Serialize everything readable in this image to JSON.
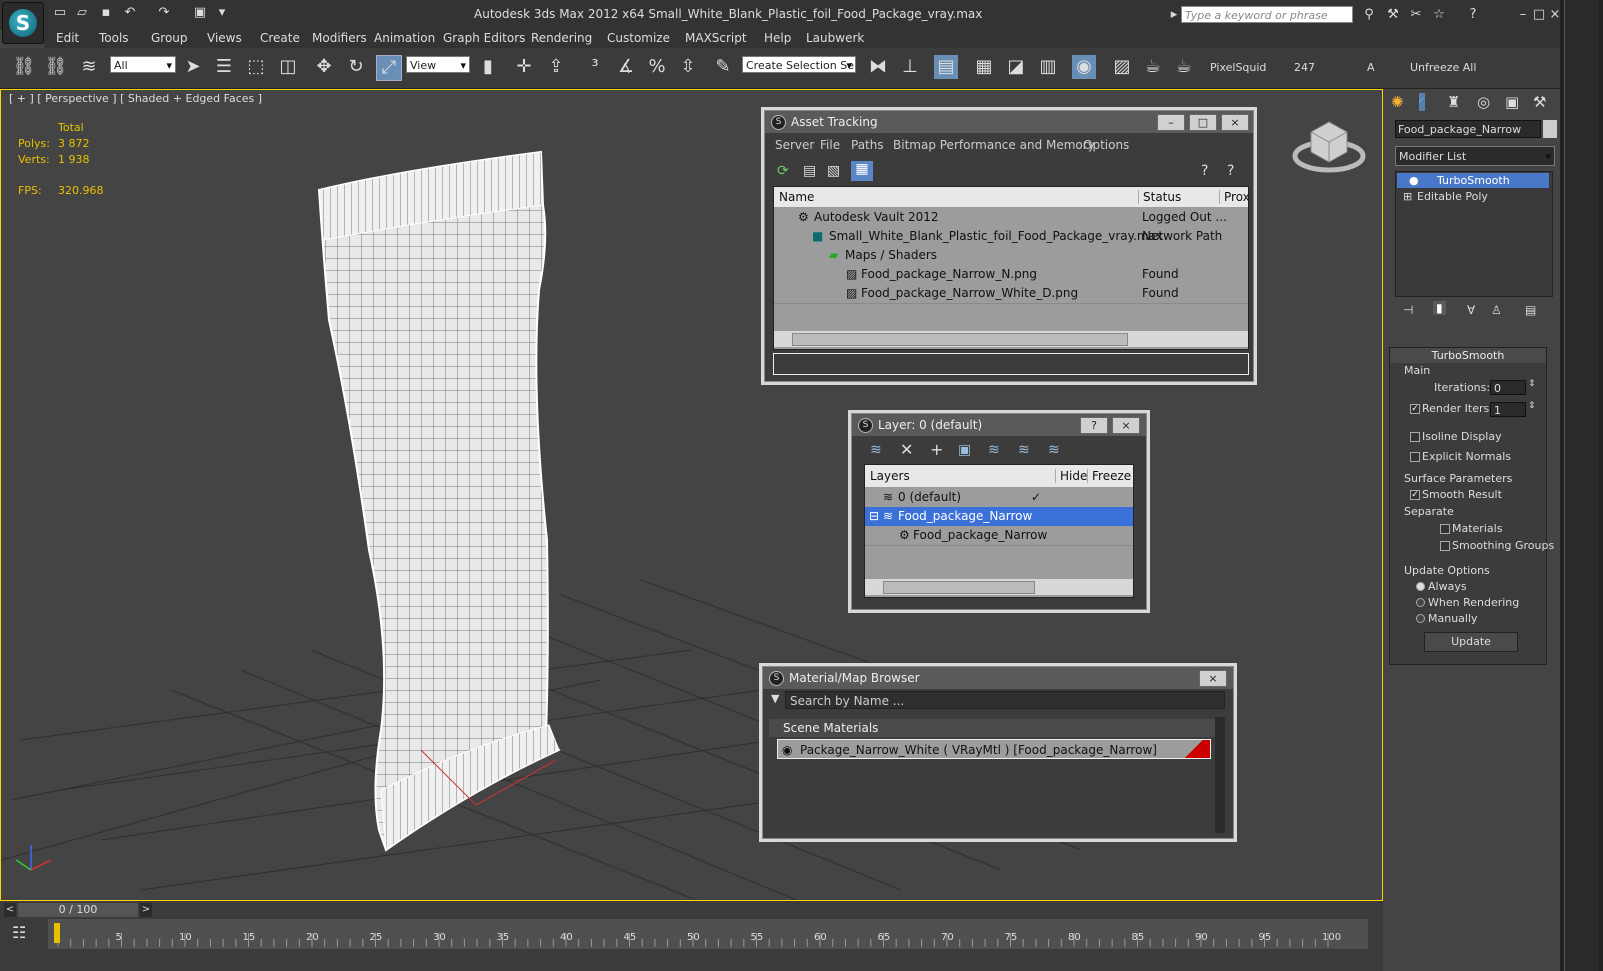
{
  "app": {
    "title": "Autodesk 3ds Max  2012 x64     Small_White_Blank_Plastic_foil_Food_Package_vray.max",
    "search_placeholder": "Type a keyword or phrase"
  },
  "menu": [
    "Edit",
    "Tools",
    "Group",
    "Views",
    "Create",
    "Modifiers",
    "Animation",
    "Graph Editors",
    "Rendering",
    "Customize",
    "MAXScript",
    "Help",
    "Laubwerk"
  ],
  "toolbar": {
    "selection_filter": "All",
    "ref_coord": "View",
    "named_selection": "Create Selection Se",
    "pixelsquid": "PixelSquid",
    "count": "247",
    "a_label": "A",
    "unfreeze_all": "Unfreeze All"
  },
  "viewport": {
    "label": "[ + ] [ Perspective ] [ Shaded + Edged Faces ]",
    "stats": {
      "total_label": "Total",
      "polys_label": "Polys:",
      "polys_value": "3 872",
      "verts_label": "Verts:",
      "verts_value": "1 938",
      "fps_label": "FPS:",
      "fps_value": "320.968"
    }
  },
  "asset_tracking": {
    "title": "Asset Tracking",
    "menu": [
      "Server",
      "File",
      "Paths",
      "Bitmap Performance and Memory",
      "Options"
    ],
    "columns": [
      "Name",
      "Status",
      "Prox"
    ],
    "rows": [
      {
        "name": "Autodesk Vault 2012",
        "status": "Logged Out ..."
      },
      {
        "name": "Small_White_Blank_Plastic_foil_Food_Package_vray.max",
        "status": "Network Path"
      },
      {
        "name": "Maps / Shaders",
        "status": ""
      },
      {
        "name": "Food_package_Narrow_N.png",
        "status": "Found"
      },
      {
        "name": "Food_package_Narrow_White_D.png",
        "status": "Found"
      }
    ]
  },
  "layer": {
    "title": "Layer: 0 (default)",
    "columns": [
      "Layers",
      "Hide",
      "Freeze"
    ],
    "rows": [
      "0 (default)",
      "Food_package_Narrow",
      "Food_package_Narrow"
    ],
    "help_label": "?"
  },
  "material_browser": {
    "title": "Material/Map Browser",
    "search_placeholder": "Search by Name ...",
    "group": "Scene Materials",
    "item": "Package_Narrow_White  ( VRayMtl )  [Food_package_Narrow]"
  },
  "command_panel": {
    "object_name": "Food_package_Narrow",
    "modifier_list": "Modifier List",
    "stack": [
      "TurboSmooth",
      "Editable Poly"
    ],
    "turbosmooth": {
      "title": "TurboSmooth",
      "main": "Main",
      "iterations_label": "Iterations:",
      "iterations_value": "0",
      "render_iters_label": "Render Iters:",
      "render_iters_value": "1",
      "isoline": "Isoline Display",
      "explicit_normals": "Explicit Normals",
      "surface_params": "Surface Parameters",
      "smooth_result": "Smooth Result",
      "separate": "Separate",
      "materials": "Materials",
      "smoothing_groups": "Smoothing Groups",
      "update_options": "Update Options",
      "always": "Always",
      "when_rendering": "When Rendering",
      "manually": "Manually",
      "update_button": "Update"
    }
  },
  "timeline": {
    "frame": "0 / 100",
    "ticks": [
      "5",
      "10",
      "15",
      "20",
      "25",
      "30",
      "35",
      "40",
      "45",
      "50",
      "55",
      "60",
      "65",
      "70",
      "75",
      "80",
      "85",
      "90",
      "95",
      "100"
    ]
  }
}
